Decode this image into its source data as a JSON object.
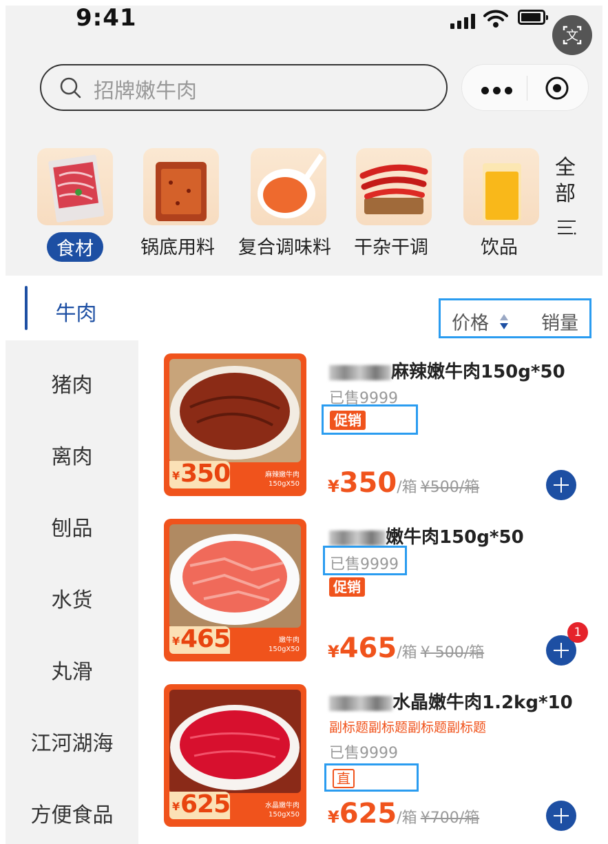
{
  "status_bar": {
    "time": "9:41",
    "translate_glyph": "文"
  },
  "search": {
    "placeholder": "招牌嫩牛肉"
  },
  "categories": [
    {
      "label": "食材",
      "active": true
    },
    {
      "label": "锅底用料",
      "active": false
    },
    {
      "label": "复合调味料",
      "active": false
    },
    {
      "label": "干杂干调",
      "active": false
    },
    {
      "label": "饮品",
      "active": false
    }
  ],
  "all_label": "全部",
  "sidebar": {
    "items": [
      "牛肉",
      "猪肉",
      "离肉",
      "刨品",
      "水货",
      "丸滑",
      "江河湖海",
      "方便食品"
    ],
    "active_index": 0
  },
  "sort": {
    "price_label": "价格",
    "sales_label": "销量"
  },
  "products": [
    {
      "title_suffix": "麻辣嫩牛肉150g*50",
      "sold": "已售9999",
      "tag": "促销",
      "tag_type": "promo",
      "subtitle": "",
      "yen": "¥",
      "price": "350",
      "unit": "/箱",
      "orig": "¥500/箱",
      "img_yen": "¥",
      "img_price": "350",
      "img_name": "麻辣嫩牛肉",
      "img_spec": "150gX50"
    },
    {
      "title_suffix": "嫩牛肉150g*50",
      "sold": "已售9999",
      "tag": "促销",
      "tag_type": "promo",
      "subtitle": "",
      "yen": "¥",
      "price": "465",
      "unit": "/箱",
      "orig": "¥ 500/箱",
      "img_yen": "¥",
      "img_price": "465",
      "img_name": "嫩牛肉",
      "img_spec": "150gX50"
    },
    {
      "title_suffix": "水晶嫩牛肉1.2kg*10",
      "sold": "已售9999",
      "tag": "直",
      "tag_type": "direct",
      "subtitle": "副标题副标题副标题副标题",
      "yen": "¥",
      "price": "625",
      "unit": "/箱",
      "orig": "¥700/箱",
      "img_yen": "¥",
      "img_price": "625",
      "img_name": "水晶嫩牛肉",
      "img_spec": "150gX50"
    }
  ],
  "cart_badge": "1",
  "colors": {
    "accent": "#1d4fa3",
    "promo": "#f0531c",
    "highlight": "#2a9cf0",
    "badge": "#e5232b"
  }
}
